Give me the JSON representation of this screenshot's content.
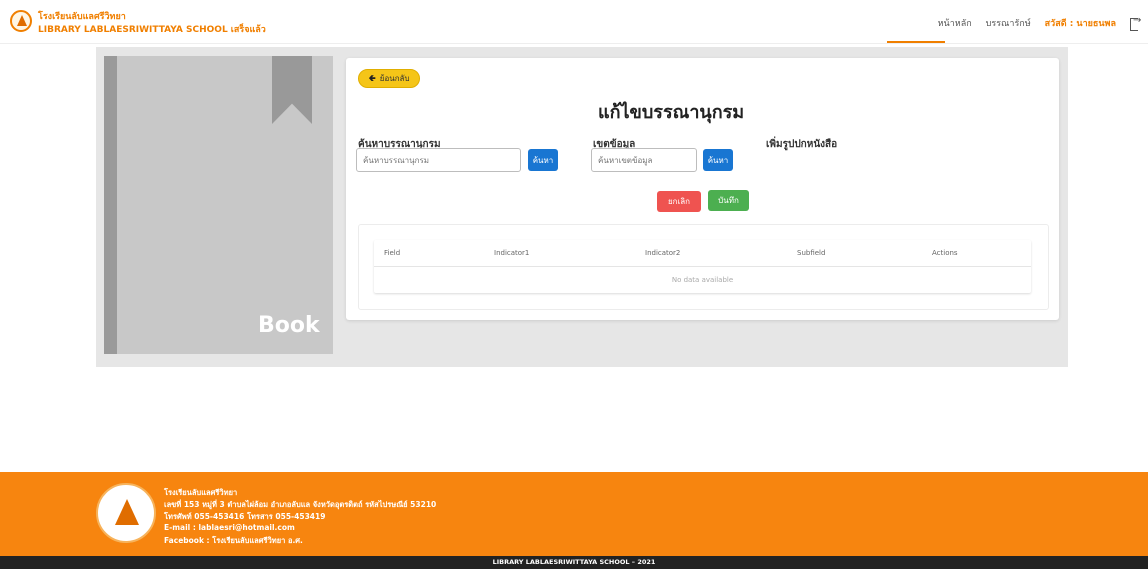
{
  "header": {
    "school_th": "โรงเรียนลับแลศรีวิทยา",
    "school_en": "LIBRARY LABLAESRIWITTAYA SCHOOL เสร็จแล้ว",
    "nav": {
      "home": "หน้าหลัก",
      "catalog": "บรรณารักษ์",
      "greeting": "สวัสดี : นายธนพล"
    }
  },
  "sidebar": {
    "book_label": "Book"
  },
  "form": {
    "back_label": "ย้อนกลับ",
    "title": "แก้ไขบรรณานุกรม",
    "search_label": "ค้นหาบรรณานุกรม",
    "search_placeholder": "ค้นหาบรรณานุกรม",
    "search_button": "ค้นหา",
    "field_label": "เขตข้อมูล",
    "field_placeholder": "ค้นหาเขตข้อมูล",
    "field_button": "ค้นหา",
    "add_cover_label": "เพิ่มรูปปกหนังสือ",
    "cancel_button": "ยกเลิก",
    "save_button": "บันทึก"
  },
  "table": {
    "columns": [
      "Field",
      "Indicator1",
      "Indicator2",
      "Subfield",
      "Actions"
    ],
    "empty_text": "No data available"
  },
  "footer": {
    "lines": [
      "โรงเรียนลับแลศรีวิทยา",
      "เลขที่ 153 หมู่ที่ 3 ตำบลไผ่ล้อม อำเภอลับแล จังหวัดอุตรดิตถ์ รหัสไปรษณีย์ 53210",
      "โทรศัพท์ 055-453416 โทรสาร 055-453419",
      "E-mail : lablaesri@hotmail.com",
      "Facebook : โรงเรียนลับแลศรีวิทยา อ.ศ."
    ],
    "copyright": "LIBRARY LABLAESRIWITTAYA SCHOOL – 2021"
  },
  "colors": {
    "brand_orange": "#f7850f",
    "back_yellow": "#f5c518",
    "primary_blue": "#1976d2",
    "cancel_red": "#ef5350",
    "save_green": "#4caf50"
  },
  "icons": [
    "logo-emblem",
    "logout-icon",
    "back-arrow-icon",
    "bookmark-icon"
  ]
}
